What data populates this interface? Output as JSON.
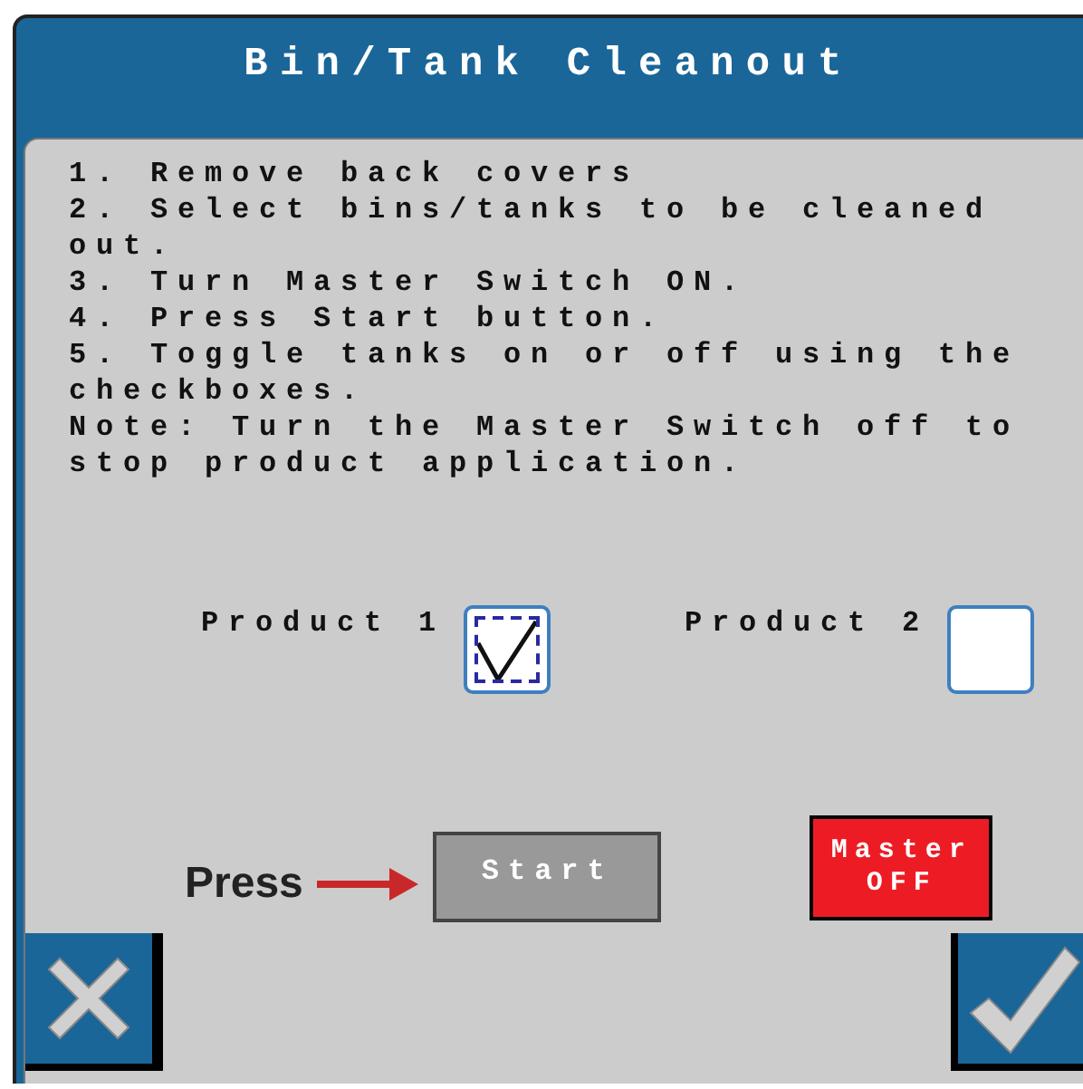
{
  "window": {
    "title": "Bin/Tank Cleanout"
  },
  "instructions": [
    "1. Remove back covers",
    "2. Select bins/tanks to be cleaned out.",
    "3. Turn Master Switch ON.",
    "4. Press Start button.",
    "5. Toggle tanks on or off using the checkboxes.",
    "Note: Turn the Master Switch off to stop product application."
  ],
  "products": [
    {
      "label": "Product 1",
      "checked": true
    },
    {
      "label": "Product 2",
      "checked": false
    }
  ],
  "annotation": {
    "text": "Press"
  },
  "start_button": {
    "label": "Start"
  },
  "master_button": {
    "label_lines": [
      "Master",
      "OFF"
    ],
    "on": false
  }
}
